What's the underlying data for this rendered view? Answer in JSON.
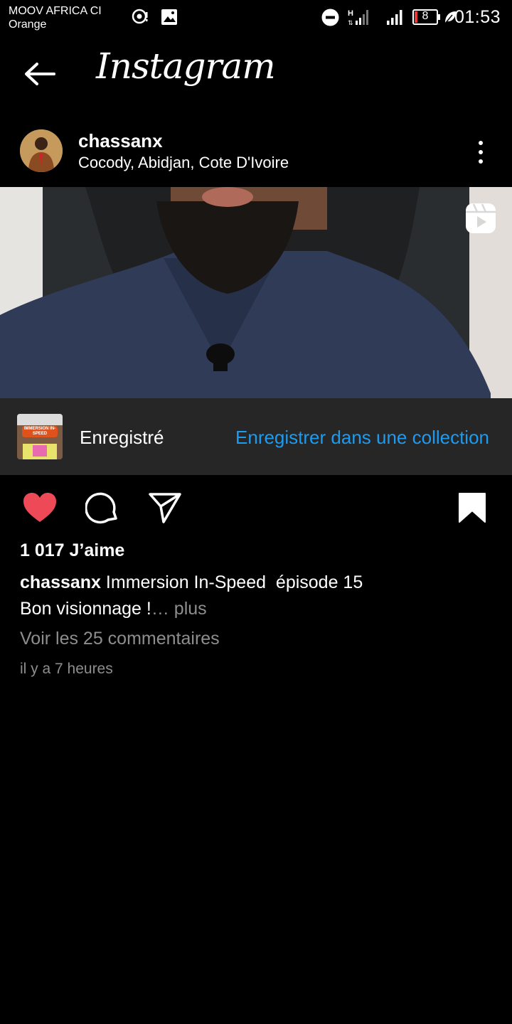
{
  "status_bar": {
    "carrier_line1": "MOOV AFRICA CI",
    "carrier_line2": "Orange",
    "battery_level": "8",
    "time": "01:53",
    "icons": [
      "hotspot-icon",
      "image-icon",
      "dnd-icon",
      "signal-h-icon",
      "signal-icon",
      "battery-icon",
      "leaf-icon"
    ]
  },
  "header": {
    "app_name": "Instagram",
    "back_icon": "arrow-left-icon"
  },
  "post": {
    "username": "chassanx",
    "location": "Cocody, Abidjan, Cote D'Ivoire",
    "more_icon": "vertical-dots-icon",
    "media_type_icon": "reels-icon"
  },
  "saved_bar": {
    "thumb_text": "IMMERSION IN-SPEED",
    "status": "Enregistré",
    "collection_action": "Enregistrer dans une collection"
  },
  "actions": {
    "like_icon": "heart-filled-icon",
    "comment_icon": "comment-icon",
    "share_icon": "send-icon",
    "save_icon": "bookmark-filled-icon",
    "liked": true,
    "saved": true
  },
  "engagement": {
    "likes": "1 017 J’aime",
    "caption_user": "chassanx",
    "caption_text": "Immersion In-Speed  épisode 15",
    "caption_line2": "Bon visionnage !",
    "more_label": "… plus",
    "comments_link": "Voir les 25 commentaires",
    "timestamp": "il y a 7 heures"
  },
  "colors": {
    "background": "#000000",
    "saved_bar": "#262626",
    "link_blue": "#1d9bf0",
    "like_red": "#ed4956",
    "muted": "#8e8e8e"
  }
}
